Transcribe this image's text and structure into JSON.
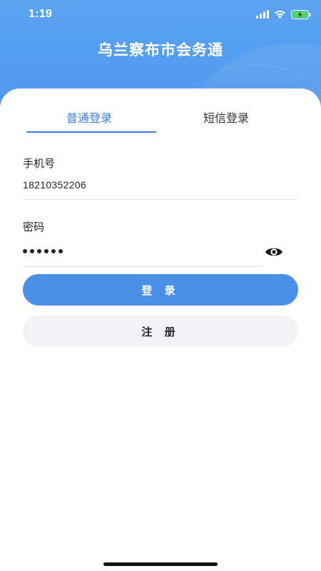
{
  "status_bar": {
    "time": "1:19"
  },
  "header": {
    "title": "乌兰察布市会务通"
  },
  "tabs": [
    {
      "label": "普通登录",
      "active": true
    },
    {
      "label": "短信登录",
      "active": false
    }
  ],
  "form": {
    "phone_label": "手机号",
    "phone_value": "18210352206",
    "password_label": "密码",
    "password_length": 6
  },
  "buttons": {
    "login_label": "登 录",
    "register_label": "注 册"
  },
  "colors": {
    "header_blue": "#4b93ea",
    "accent": "#3a7fe0",
    "login_button": "#4a8fe7",
    "register_button": "#f2f2f7"
  },
  "icons": {
    "signal": "cellular-signal-icon",
    "wifi": "wifi-icon",
    "battery": "battery-charging-icon",
    "password_toggle": "eye-icon"
  }
}
